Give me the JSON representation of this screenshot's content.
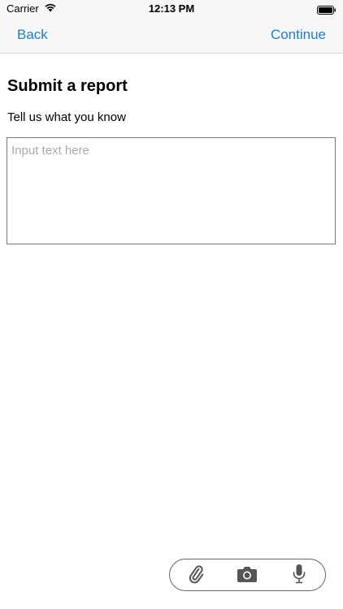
{
  "status_bar": {
    "carrier": "Carrier",
    "time": "12:13 PM",
    "wifi_icon": "wifi-icon",
    "battery_icon": "battery-icon"
  },
  "nav": {
    "back_label": "Back",
    "continue_label": "Continue",
    "accent_color": "#1a7fd4"
  },
  "content": {
    "title": "Submit a report",
    "subtitle": "Tell us what you know",
    "input_placeholder": "Input text here",
    "input_value": ""
  },
  "toolbar": {
    "icons": [
      "paperclip-icon",
      "camera-icon",
      "microphone-icon"
    ],
    "icon_color": "#555555"
  }
}
